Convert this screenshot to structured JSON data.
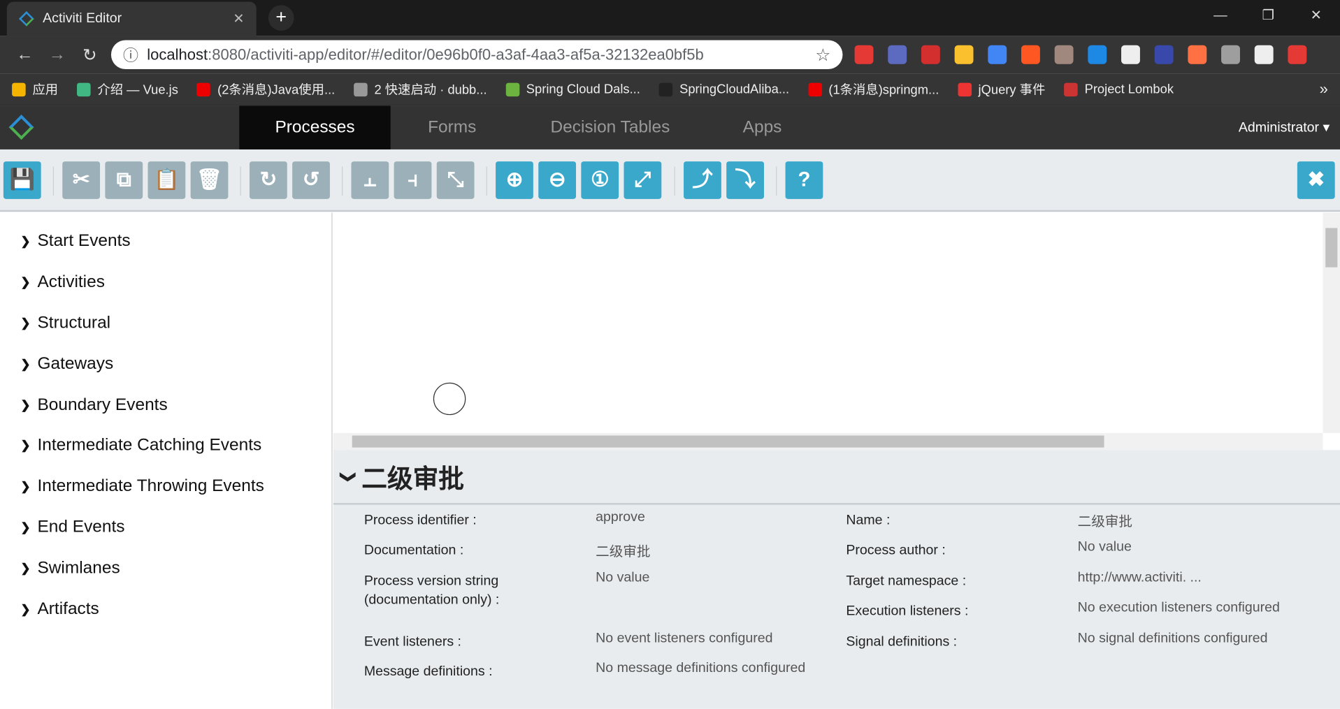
{
  "browser": {
    "tab_title": "Activiti Editor",
    "url_host": "localhost",
    "url_path": ":8080/activiti-app/editor/#/editor/0e96b0f0-a3af-4aa3-af5a-32132ea0bf5b",
    "bookmarks": [
      "应用",
      "介绍 — Vue.js",
      "(2条消息)Java使用...",
      "2 快速启动 · dubb...",
      "Spring Cloud Dals...",
      "SpringCloudAliba...",
      "(1条消息)springm...",
      "jQuery 事件",
      "Project Lombok"
    ],
    "bookmark_colors": [
      "#f4b400",
      "#41b883",
      "#e00",
      "#999",
      "#6db33f",
      "#222",
      "#e00",
      "#e33",
      "#c33"
    ],
    "extension_colors": [
      "#e53935",
      "#5c6bc0",
      "#d32f2f",
      "#fbc02d",
      "#4285f4",
      "#ff5722",
      "#a1887f",
      "#1e88e5",
      "#eee",
      "#3949ab",
      "#ff7043",
      "#9e9e9e",
      "#eee",
      "#e53935"
    ]
  },
  "app": {
    "tabs": [
      "Processes",
      "Forms",
      "Decision Tables",
      "Apps"
    ],
    "user": "Administrator ▾"
  },
  "toolbar": {
    "buttons": [
      {
        "name": "save",
        "glyph": "💾",
        "style": "t"
      },
      {
        "name": "cut",
        "glyph": "✂",
        "style": "g"
      },
      {
        "name": "copy",
        "glyph": "⧉",
        "style": "g"
      },
      {
        "name": "paste",
        "glyph": "📋",
        "style": "g"
      },
      {
        "name": "delete",
        "glyph": "🗑",
        "style": "g"
      },
      {
        "name": "redo",
        "glyph": "↻",
        "style": "g"
      },
      {
        "name": "undo",
        "glyph": "↺",
        "style": "g"
      },
      {
        "name": "align-horizontal",
        "glyph": "⫠",
        "style": "g"
      },
      {
        "name": "align-vertical",
        "glyph": "⫞",
        "style": "g"
      },
      {
        "name": "same-size",
        "glyph": "⤡",
        "style": "g"
      },
      {
        "name": "zoom-in",
        "glyph": "⊕",
        "style": "t"
      },
      {
        "name": "zoom-out",
        "glyph": "⊖",
        "style": "t"
      },
      {
        "name": "zoom-actual",
        "glyph": "①",
        "style": "t"
      },
      {
        "name": "zoom-fit",
        "glyph": "⤢",
        "style": "t"
      },
      {
        "name": "bendpoint-add",
        "glyph": "⤴",
        "style": "t"
      },
      {
        "name": "bendpoint-remove",
        "glyph": "⤵",
        "style": "t"
      },
      {
        "name": "help",
        "glyph": "?",
        "style": "t"
      }
    ],
    "close_glyph": "✖"
  },
  "palette": [
    "Start Events",
    "Activities",
    "Structural",
    "Gateways",
    "Boundary Events",
    "Intermediate Catching Events",
    "Intermediate Throwing Events",
    "End Events",
    "Swimlanes",
    "Artifacts"
  ],
  "properties": {
    "title": "二级审批",
    "left": [
      {
        "label": "Process identifier :",
        "value": "approve"
      },
      {
        "label": "Documentation :",
        "value": "二级审批"
      },
      {
        "label": "Process version string (documentation only) :",
        "value": "No value"
      },
      {
        "label": "Event listeners :",
        "value": "No event listeners configured"
      },
      {
        "label": "Message definitions :",
        "value": "No message definitions configured"
      }
    ],
    "right": [
      {
        "label": "Name :",
        "value": "二级审批"
      },
      {
        "label": "Process author :",
        "value": "No value"
      },
      {
        "label": "Target namespace :",
        "value": "http://www.activiti. ..."
      },
      {
        "label": "Execution listeners :",
        "value": "No execution listeners configured"
      },
      {
        "label": "Signal definitions :",
        "value": "No signal definitions configured"
      }
    ]
  }
}
